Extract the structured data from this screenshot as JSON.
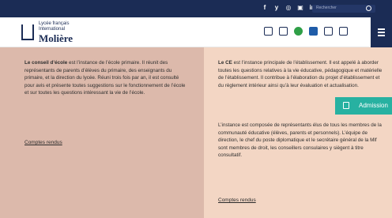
{
  "topbar": {
    "social": [
      "f",
      "y",
      "◎",
      "▣",
      "in"
    ],
    "search_placeholder": "Rechercher"
  },
  "header": {
    "logo": {
      "line1": "Lycée français",
      "line2": "International",
      "line3": "Molière"
    },
    "icons": [
      "calendar-icon",
      "people-icon",
      "green-circle-icon",
      "blue-grid-icon",
      "document-icon",
      "bag-icon"
    ],
    "menu_icon": "hamburger-icon"
  },
  "left": {
    "lead_bold": "Le conseil d’école",
    "paragraph": " est l’instance de l’école primaire. Il réunit des représentants de parents d’élèves du primaire, des enseignants du primaire, et la direction du lycée. Réuni trois fois par an, il est consulté pour avis et présente toutes suggestions sur le fonctionnement de l’école et sur toutes les questions intéressant la vie de l’école.",
    "link": "Comptes rendus"
  },
  "right": {
    "lead_bold": "Le CE",
    "paragraph1": " est l’instance principale de l’établissement. Il est appelé à aborder toutes les questions relatives à la vie éducative, pédagogique et matérielle de l’établissement. Il contribue à l’élaboration du projet d’établissement et du règlement intérieur ainsi qu’à leur évaluation et actualisation.",
    "paragraph2": "L’instance est composée de représentants élus de tous les membres de la communauté éducative (élèves, parents et personnels). L’équipe de direction, le chef du poste diplomatique et le secrétaire général de la Mlf sont membres de droit, les conseillers consulaires y siègent à titre consultatif.",
    "link": "Comptes rendus"
  },
  "floating": {
    "admission_label": "Admission"
  },
  "colors": {
    "navy": "#1b2c55",
    "teal": "#27b1a1",
    "left_bg": "#dcb9ab",
    "right_bg": "#f3d6c4"
  }
}
